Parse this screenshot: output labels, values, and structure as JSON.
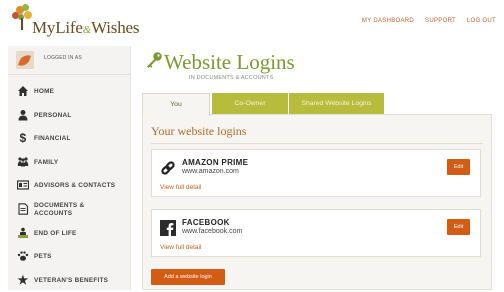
{
  "brand": {
    "logo_text_1": "MyLife",
    "logo_and": "&",
    "logo_text_2": "Wishes"
  },
  "top_nav": {
    "dashboard": "MY DASHBOARD",
    "support": "SUPPORT",
    "logout": "LOG OUT"
  },
  "user": {
    "logged_in_label": "LOGGED IN AS"
  },
  "sidebar": {
    "items": [
      {
        "label": "HOME",
        "icon": "home-icon"
      },
      {
        "label": "PERSONAL",
        "icon": "person-icon"
      },
      {
        "label": "FINANCIAL",
        "icon": "dollar-icon"
      },
      {
        "label": "FAMILY",
        "icon": "family-icon"
      },
      {
        "label": "ADVISORS & CONTACTS",
        "icon": "contact-card-icon"
      },
      {
        "label": "DOCUMENTS & ACCOUNTS",
        "icon": "document-icon"
      },
      {
        "label": "END OF LIFE",
        "icon": "end-of-life-icon"
      },
      {
        "label": "PETS",
        "icon": "paw-icon"
      },
      {
        "label": "VETERAN'S BENEFITS",
        "icon": "star-icon"
      }
    ]
  },
  "page": {
    "title": "Website Logins",
    "subtitle": "IN DOCUMENTS & ACCOUNTS",
    "tabs": [
      {
        "label": "You"
      },
      {
        "label": "Co-Owner"
      },
      {
        "label": "Shared Website Logins"
      }
    ],
    "panel_title": "Your website logins",
    "logins": [
      {
        "name": "AMAZON PRIME",
        "url": "www.amazon.com",
        "detail_link": "View full detail",
        "edit_label": "Edit",
        "icon": "link-icon"
      },
      {
        "name": "FACEBOOK",
        "url": "www.facebook.com",
        "detail_link": "View full detail",
        "edit_label": "Edit",
        "icon": "facebook-icon"
      }
    ],
    "add_button": "Add a website login"
  },
  "colors": {
    "accent_orange": "#d35c14",
    "olive": "#b7bc3d",
    "title_green": "#7a9a2e"
  }
}
